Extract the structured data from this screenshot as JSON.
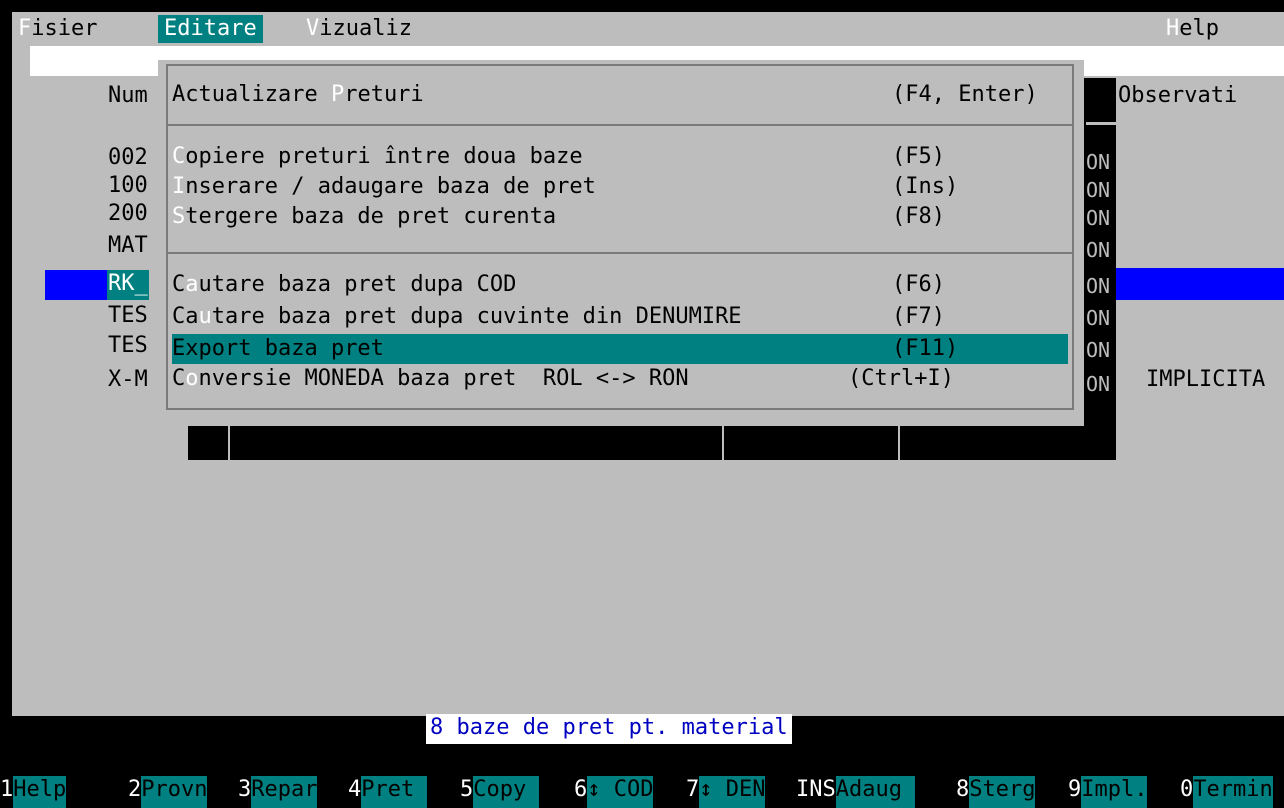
{
  "menubar": {
    "fisier_hk": "F",
    "fisier_rest": "isier",
    "editare": "Editare",
    "vizualiz_hk": "V",
    "vizualiz_rest": "izualiz",
    "help_hk": "H",
    "help_rest": "elp"
  },
  "table": {
    "header_num": "Num",
    "header_obs": "Observati",
    "rows": [
      "002",
      "100",
      "200",
      "MAT",
      "RK_",
      "TES",
      "TES",
      "X-M"
    ],
    "implicita": "IMPLICITA",
    "on_marker": "ON"
  },
  "menu": {
    "items": [
      {
        "pre": "Actualizare ",
        "hk": "P",
        "post": "returi",
        "key": "(F4, Enter)"
      },
      {
        "pre": "",
        "hk": "C",
        "post": "opiere preturi între doua baze",
        "key": "(F5)"
      },
      {
        "pre": "",
        "hk": "I",
        "post": "nserare / adaugare baza de pret",
        "key": "(Ins)"
      },
      {
        "pre": "",
        "hk": "S",
        "post": "tergere baza de pret curenta",
        "key": "(F8)"
      },
      {
        "pre": "C",
        "hk": "a",
        "post": "utare baza pret dupa COD",
        "key": "(F6)"
      },
      {
        "pre": "Ca",
        "hk": "u",
        "post": "tare baza pret dupa cuvinte din DENUMIRE",
        "key": "(F7)"
      },
      {
        "pre": "",
        "hk": "E",
        "post": "xport baza pret",
        "key": "(F11)"
      },
      {
        "pre": "C",
        "hk": "o",
        "post": "nversie MONEDA baza pret  ROL <-> RON",
        "key": "(Ctrl+I)"
      }
    ]
  },
  "status": "8 baze de pret pt. material",
  "fkeys": [
    {
      "n": "1",
      "t": "Help"
    },
    {
      "n": "2",
      "t": "Provn"
    },
    {
      "n": "3",
      "t": "Repar"
    },
    {
      "n": "4",
      "t": "Pret "
    },
    {
      "n": "5",
      "t": "Copy "
    },
    {
      "n": "6",
      "t": "↕ COD"
    },
    {
      "n": "7",
      "t": "↕ DEN"
    },
    {
      "n": "INS",
      "t": "Adaug "
    },
    {
      "n": "8",
      "t": "Sterg"
    },
    {
      "n": "9",
      "t": "Impl."
    },
    {
      "n": "0",
      "t": "Termin"
    }
  ]
}
